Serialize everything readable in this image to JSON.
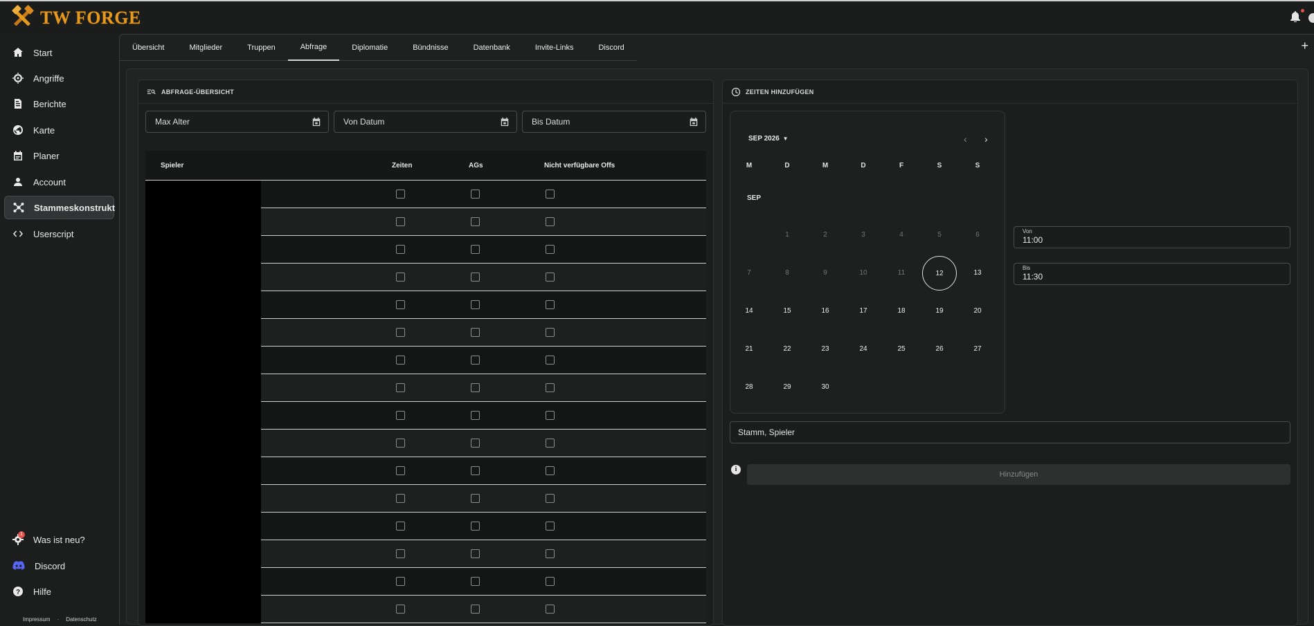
{
  "app": {
    "brand": "TW FORGE"
  },
  "sidebar": {
    "items": [
      {
        "label": "Start",
        "icon": "home-icon"
      },
      {
        "label": "Angriffe",
        "icon": "target-icon"
      },
      {
        "label": "Berichte",
        "icon": "document-icon"
      },
      {
        "label": "Karte",
        "icon": "globe-icon"
      },
      {
        "label": "Planer",
        "icon": "calendar-icon"
      },
      {
        "label": "Account",
        "icon": "person-icon"
      },
      {
        "label": "Stammeskonstrukt",
        "icon": "network-icon"
      },
      {
        "label": "Userscript",
        "icon": "code-icon"
      }
    ],
    "bottom_items": [
      {
        "label": "Was ist neu?",
        "icon": "gear-badge-icon",
        "badge": "1"
      },
      {
        "label": "Discord",
        "icon": "discord-icon"
      },
      {
        "label": "Hilfe",
        "icon": "help-icon"
      }
    ],
    "footer": {
      "impressum": "Impressum",
      "separator": "·",
      "datenschutz": "Datenschutz"
    }
  },
  "tabs": [
    "Übersicht",
    "Mitglieder",
    "Truppen",
    "Abfrage",
    "Diplomatie",
    "Bündnisse",
    "Datenbank",
    "Invite-Links",
    "Discord"
  ],
  "active_tab": "Abfrage",
  "overview": {
    "title": "ABFRAGE-ÜBERSICHT",
    "filters": {
      "max_alter": "Max Alter",
      "von_datum": "Von Datum",
      "bis_datum": "Bis Datum"
    },
    "columns": {
      "spieler": "Spieler",
      "zeiten": "Zeiten",
      "ags": "AGs",
      "offs": "Nicht verfügbare Offs"
    },
    "row_count": 16
  },
  "add_times": {
    "title": "ZEITEN HINZUFÜGEN",
    "calendar": {
      "month_year": "SEP 2026",
      "month_label": "SEP",
      "weekdays": [
        "M",
        "D",
        "M",
        "D",
        "F",
        "S",
        "S"
      ],
      "selected_day": 12,
      "disabled_days": [
        1,
        2,
        3,
        4,
        5,
        6,
        7,
        8,
        9,
        10,
        11
      ],
      "days_in_month": 30,
      "first_weekday_index": 1,
      "prev_icon": "chevron-left-icon",
      "next_icon": "chevron-right-icon"
    },
    "von": {
      "label": "Von",
      "value": "11:00"
    },
    "bis": {
      "label": "Bis",
      "value": "11:30"
    },
    "stamm_spieler": "Stamm, Spieler",
    "add_button": "Hinzufügen"
  },
  "colors": {
    "accent_logo": "#e69a1d",
    "badge": "#e0524b",
    "discord": "#5865f2"
  }
}
